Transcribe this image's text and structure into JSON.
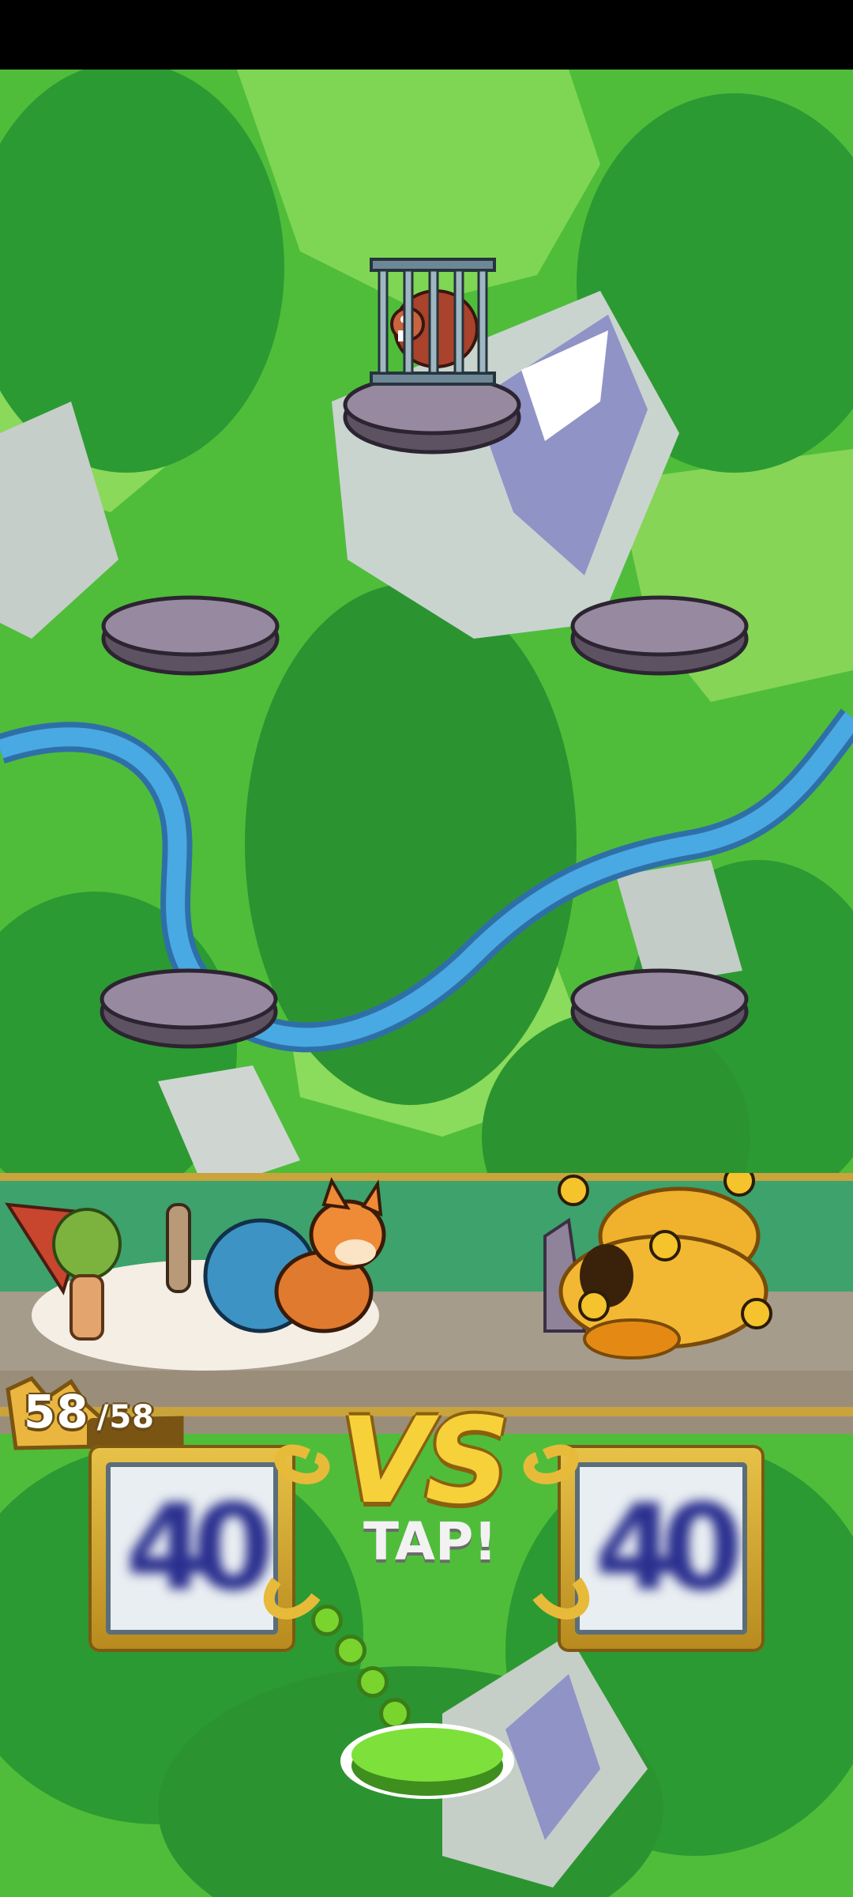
{
  "player": {
    "hp_current": "58",
    "hp_max": "/58"
  },
  "battle": {
    "vs_label": "VS",
    "tap_label": "TAP!"
  },
  "cards": {
    "left_value": "40",
    "right_value": "40"
  },
  "colors": {
    "grass": "#47b83a",
    "forest": "#2f9a30",
    "river": "#3e9ad6",
    "platform": "#8a7f92",
    "gold": "#f6d13a"
  },
  "icons": [
    "cage-icon",
    "monster-icon",
    "beehive-icon",
    "bee-icon",
    "fox-icon",
    "tap-button-icon"
  ]
}
